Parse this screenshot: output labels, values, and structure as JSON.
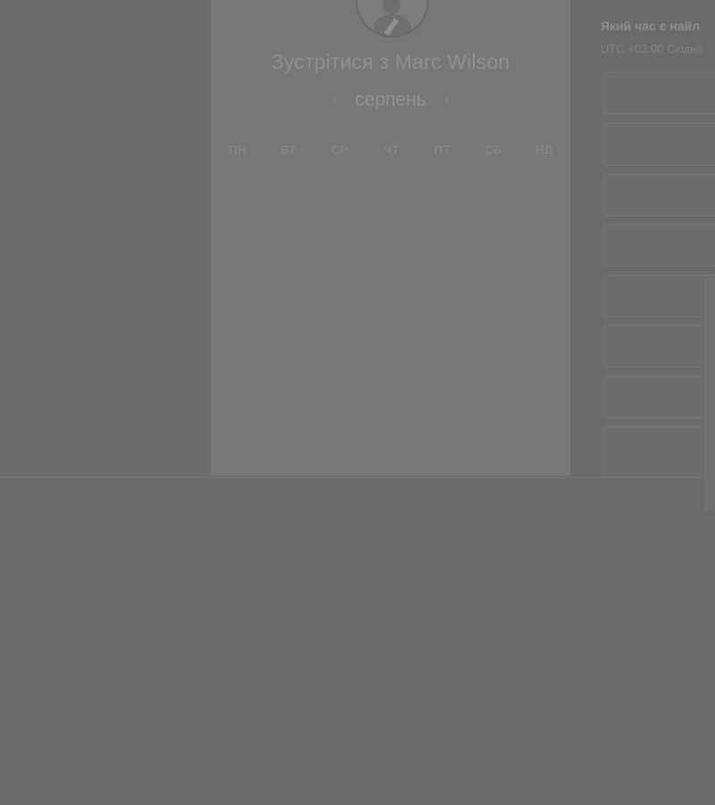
{
  "host": {
    "title": "Зустрітися з Marc Wilson",
    "avatar_icon": "user-avatar"
  },
  "calendar": {
    "month": "серпень",
    "prev_icon": "chevron-left-icon",
    "next_icon": "chevron-right-icon",
    "weekdays": [
      "ПН",
      "ВТ",
      "СР",
      "ЧТ",
      "ПТ",
      "СБ",
      "НД"
    ]
  },
  "times": {
    "question": "Який час є найл",
    "timezone": "UTC +03:00 Східно",
    "slot_count": 8
  },
  "colors": {
    "overlay_bg": "#6b6b6b",
    "card_bg": "#787878"
  }
}
